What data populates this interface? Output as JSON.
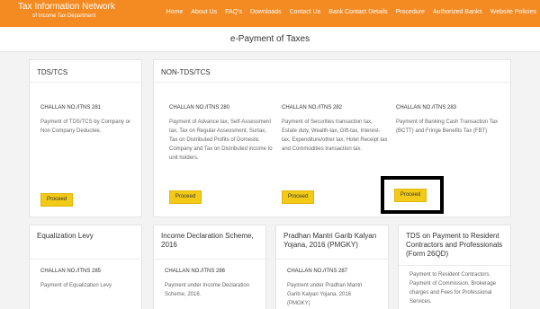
{
  "header": {
    "logo_line1": "Tax Information Network",
    "logo_line2": "of Income Tax Department",
    "nav": [
      "Home",
      "About Us",
      "FAQ's",
      "Downloads",
      "Contact Us",
      "Bank Contact Details",
      "Procedure",
      "Authorized Banks",
      "Website Policies"
    ]
  },
  "page_title": "e-Payment of Taxes",
  "tds": {
    "title": "TDS/TCS",
    "challan_no": "CHALLAN NO./ITNS 281",
    "desc": "Payment of TDS/TCS by Company or Non Company Deductee.",
    "button": "Proceed"
  },
  "non_tds": {
    "title": "NON-TDS/TCS",
    "items": [
      {
        "challan_no": "CHALLAN NO./ITNS 280",
        "desc": "Payment of Advance tax, Self-Assessment tax, Tax on Regular Assessment, Surtax, Tax on Distributed Profits of Domestic Company and Tax on Distributed income to unit holders.",
        "button": "Proceed"
      },
      {
        "challan_no": "CHALLAN NO./ITNS 282",
        "desc": "Payment of Securities transaction tax, Estate duty, Wealth-tax, Gift-tax, Interest-tax, Expenditure/other tax, Hotel Receipt tax and Commodities transaction tax.",
        "button": "Proceed"
      },
      {
        "challan_no": "CHALLAN NO./ITNS 283",
        "desc": "Payment of Banking Cash Transaction Tax (BCTT) and Fringe Benefits Tax (FBT)",
        "button": "Proceed"
      }
    ]
  },
  "bottom": [
    {
      "title": "Equalization Levy",
      "challan_no": "CHALLAN NO./ITNS 285",
      "desc": "Payment of Equalization Levy"
    },
    {
      "title": "Income Declaration Scheme, 2016",
      "challan_no": "CHALLAN NO./ITNS 286",
      "desc": "Payment under Income Declaration Scheme, 2016."
    },
    {
      "title": "Pradhan Mantri Garib Kalyan Yojana, 2016 (PMGKY)",
      "challan_no": "CHALLAN NO./ITNS 287",
      "desc": "Payment under Pradhan Mantri Garib Kalyan Yojana, 2016 (PMGKY)"
    },
    {
      "title": "TDS on Payment to Resident Contractors and Professionals (Form 26QD)",
      "challan_no": "",
      "desc": "Payment to Resident Contractors, Payment of Commission, Brokerage charges and Fees for Professional Services."
    }
  ],
  "colors": {
    "header_bg": "#f48a22",
    "button_bg": "#f3ca16",
    "highlight_border": "#000000"
  }
}
